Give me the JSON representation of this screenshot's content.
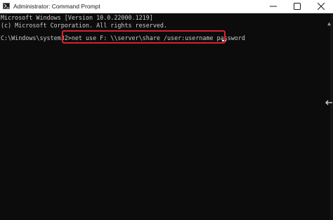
{
  "window": {
    "title": "Administrator: Command Prompt",
    "controls": [
      "minimize-icon",
      "maximize-icon",
      "close-icon"
    ]
  },
  "terminal": {
    "lines": [
      "Microsoft Windows [Version 10.0.22000.1219]",
      "(c) Microsoft Corporation. All rights reserved."
    ],
    "prompt": "C:\\Windows\\system32>",
    "command": "net use F: \\\\server\\share /user:username password"
  },
  "colors": {
    "background": "#0c0c0c",
    "text": "#cccccc",
    "highlight": "#e0202c"
  }
}
